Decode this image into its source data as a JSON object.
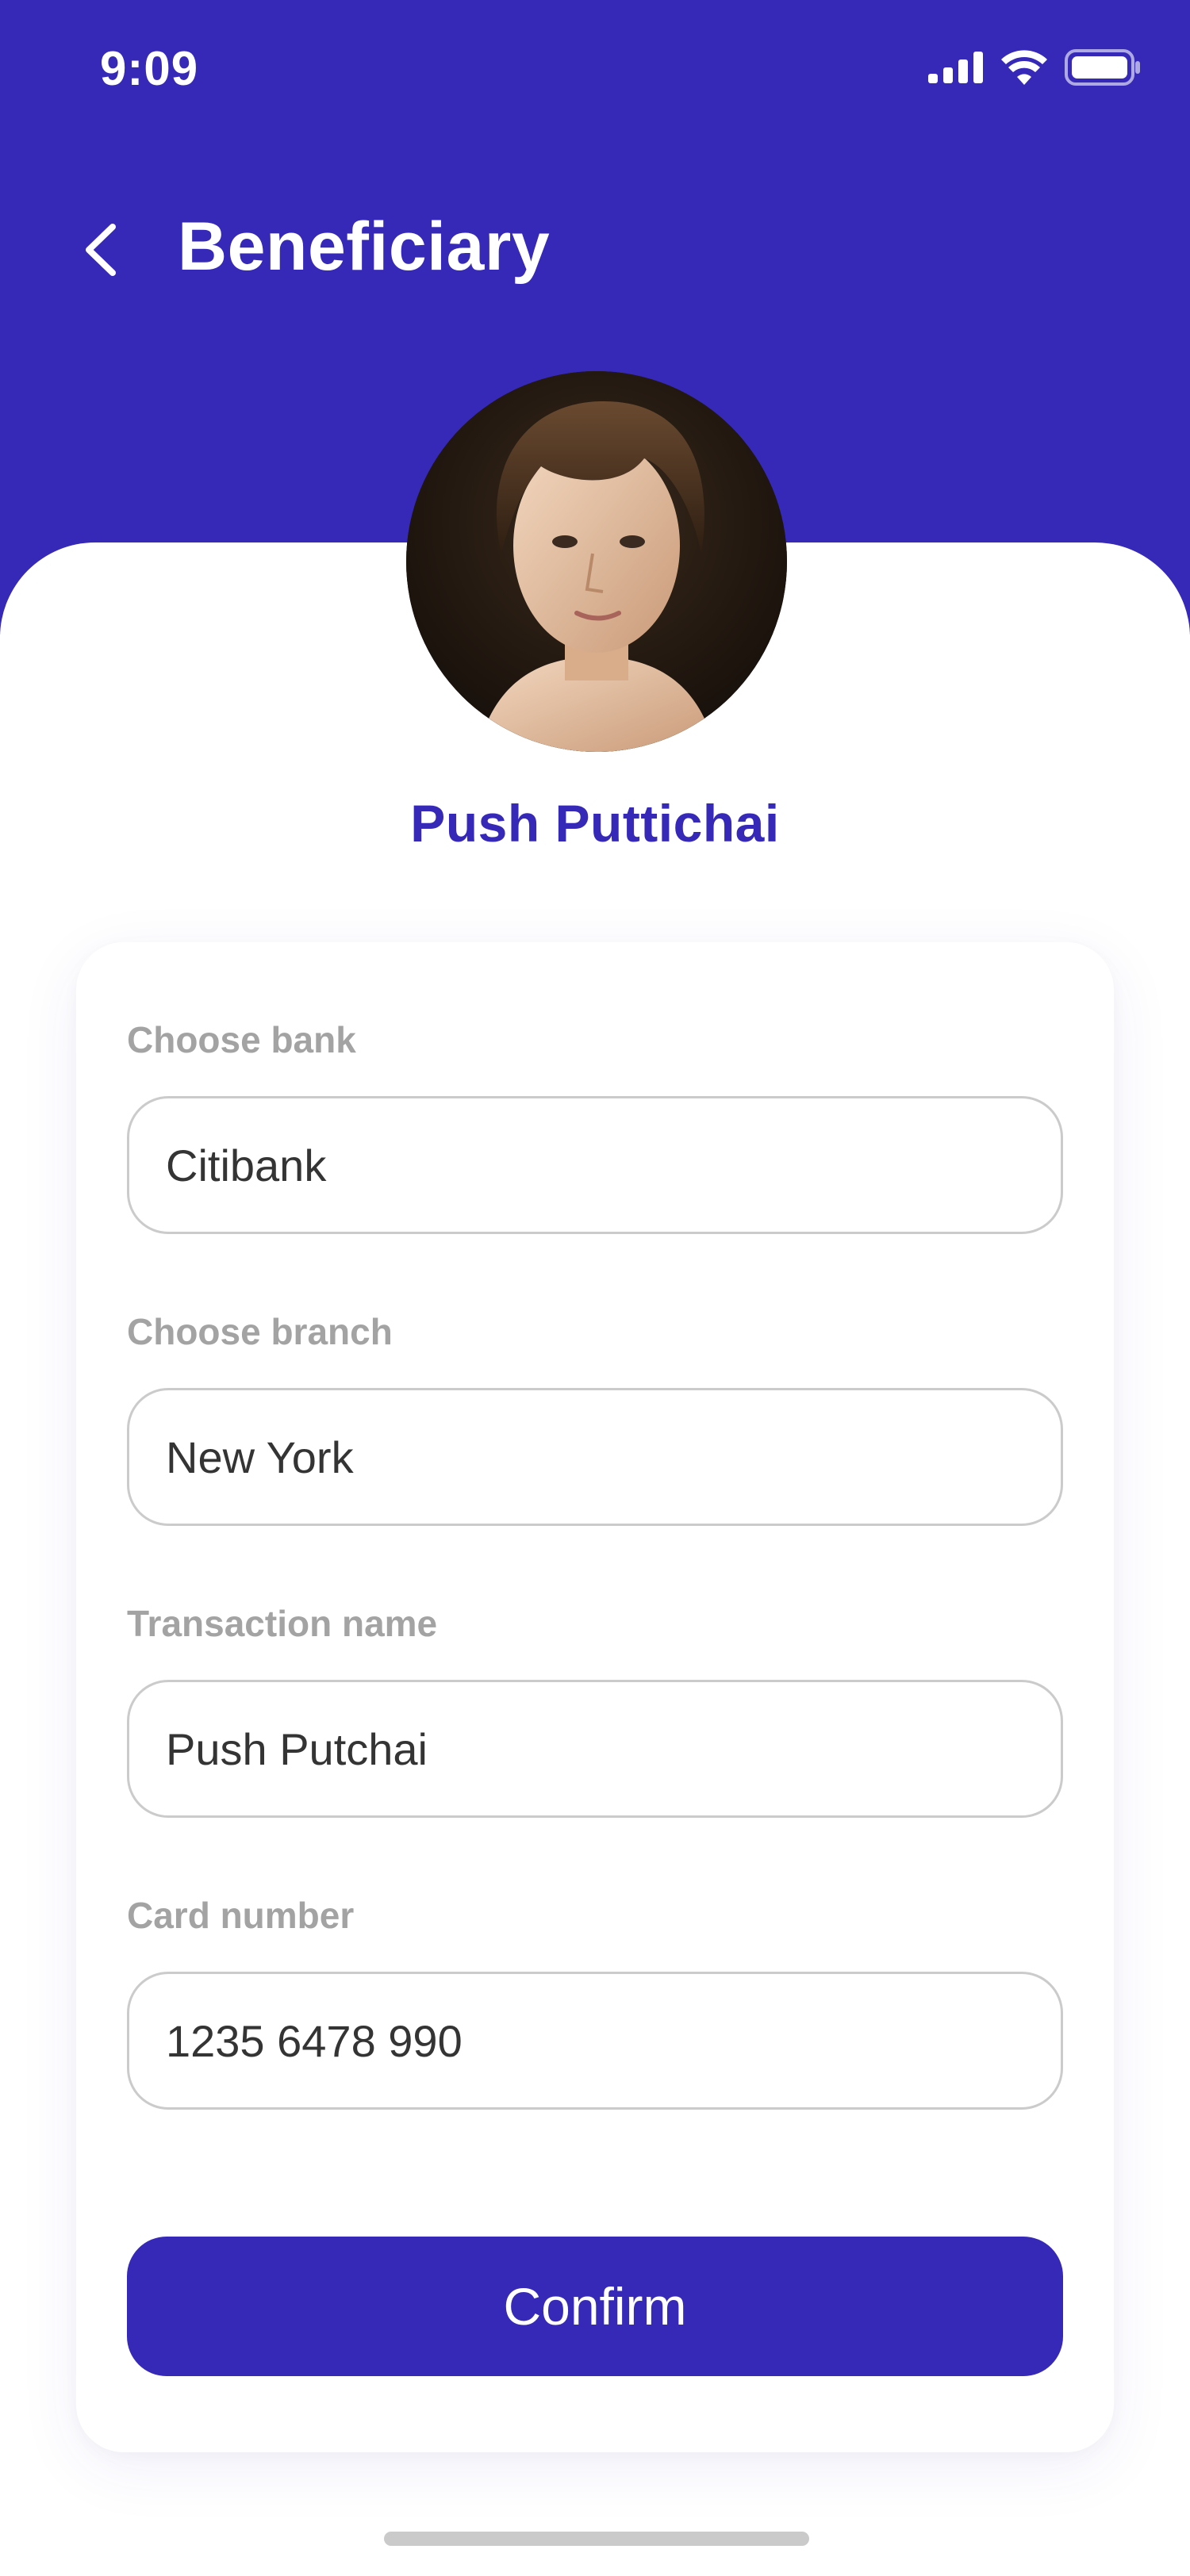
{
  "status_bar": {
    "time": "9:09",
    "icons": [
      "signal-icon",
      "wifi-icon",
      "battery-icon"
    ]
  },
  "header": {
    "title": "Beneficiary",
    "back_icon": "chevron-left-icon",
    "background_color": "#3629B7"
  },
  "profile": {
    "name": "Push Puttichai",
    "avatar": "user-photo"
  },
  "form": {
    "fields": [
      {
        "label": "Choose bank",
        "value": "Citibank"
      },
      {
        "label": "Choose branch",
        "value": "New York"
      },
      {
        "label": "Transaction name",
        "value": "Push Putchai"
      },
      {
        "label": "Card number",
        "value": "1235 6478 990"
      }
    ],
    "confirm_label": "Confirm"
  },
  "colors": {
    "primary": "#3629B7",
    "label": "#A3A3A3",
    "input_border": "#CBCBCB",
    "text": "#343434"
  }
}
